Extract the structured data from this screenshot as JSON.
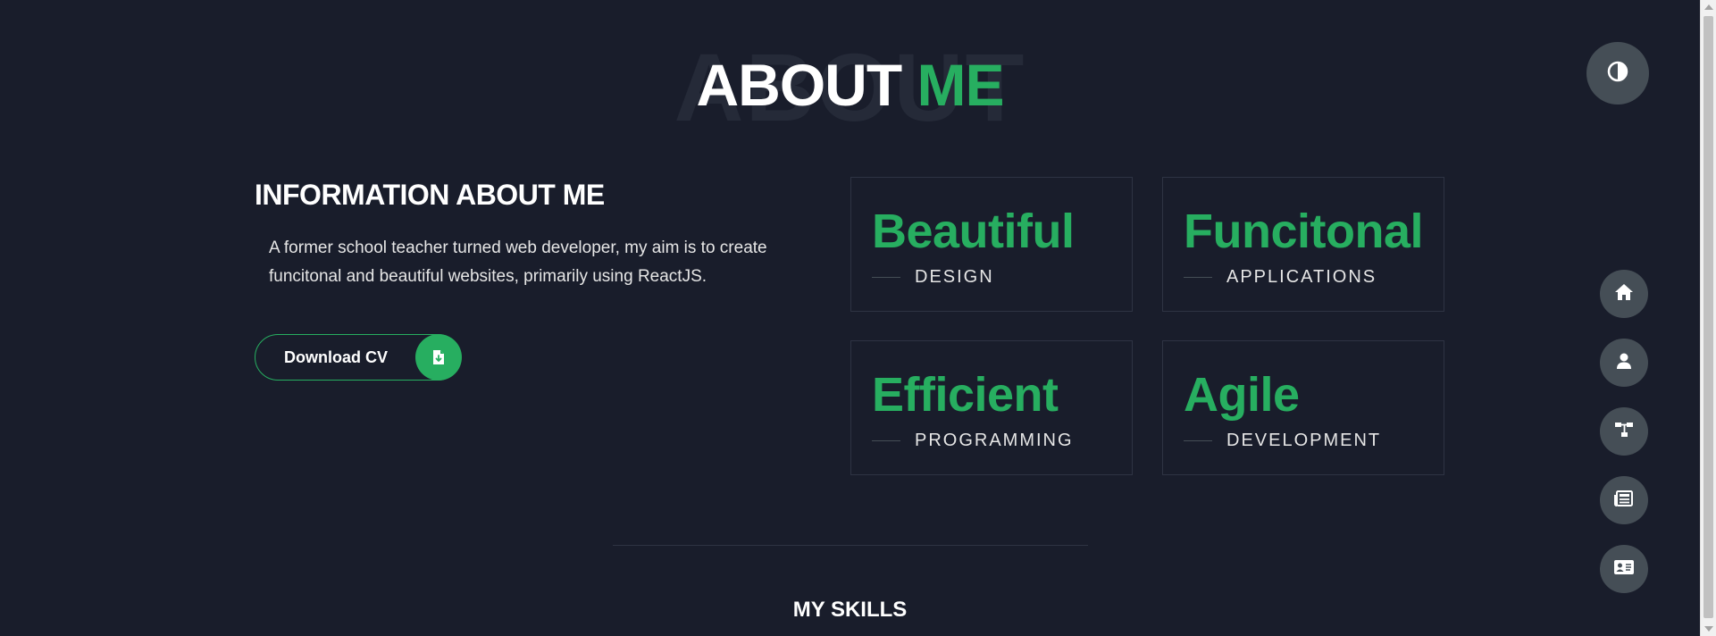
{
  "about": {
    "heading_bg": "ABOUT",
    "heading_main": "ABOUT",
    "heading_accent": "ME"
  },
  "info": {
    "title": "INFORMATION ABOUT ME",
    "text": "A former school teacher turned web developer, my aim is to create funcitonal and beautiful websites, primarily using ReactJS.",
    "cv_button": "Download CV",
    "cv_icon": "file-download-icon"
  },
  "cards": [
    {
      "big": "Beautiful",
      "small": "DESIGN"
    },
    {
      "big": "Funcitonal",
      "small": "APPLICATIONS"
    },
    {
      "big": "Efficient",
      "small": "PROGRAMMING"
    },
    {
      "big": "Agile",
      "small": "DEVELOPMENT"
    }
  ],
  "skills": {
    "title": "MY SKILLS"
  },
  "controls": {
    "theme_icon": "contrast-icon",
    "nav_icons": [
      "home-icon",
      "user-icon",
      "sitemap-icon",
      "newspaper-icon",
      "contact-card-icon"
    ]
  },
  "colors": {
    "background": "#191d2b",
    "accent": "#27ae60",
    "button_grey": "#454e56",
    "text": "#ffffff"
  }
}
